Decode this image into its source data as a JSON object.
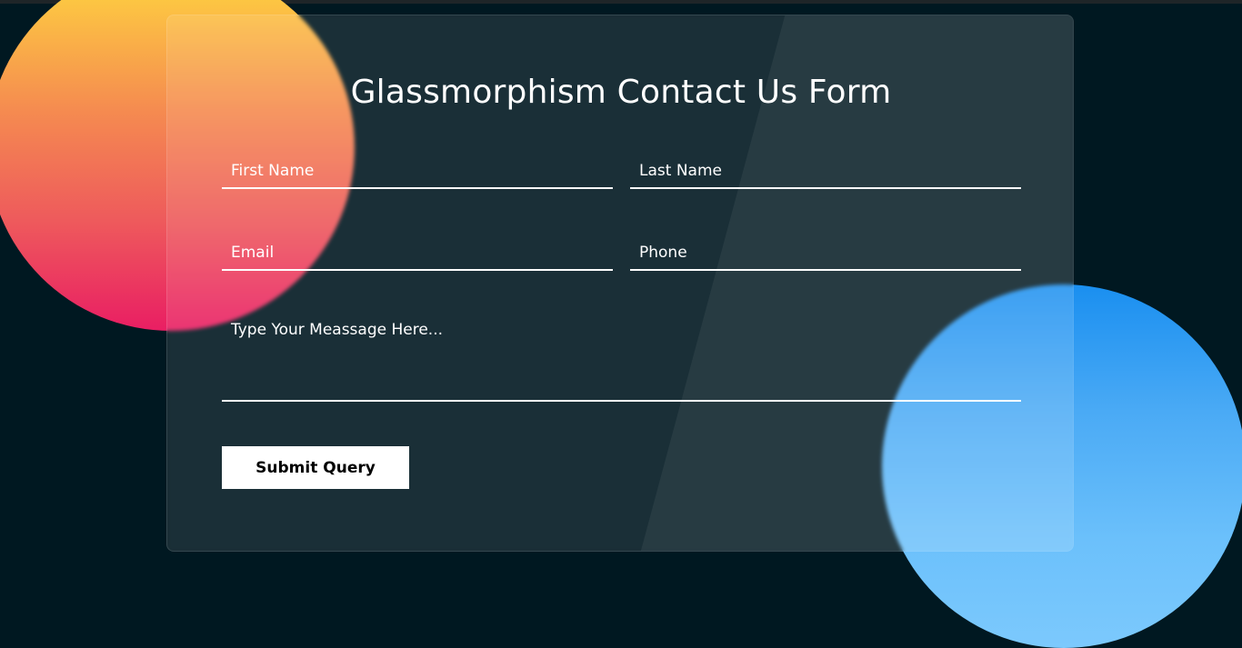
{
  "form": {
    "title": "Glassmorphism Contact Us Form",
    "fields": {
      "first_name": "First Name",
      "last_name": "Last Name",
      "email": "Email",
      "phone": "Phone",
      "message": "Type Your Meassage Here..."
    },
    "submit_label": "Submit Query"
  },
  "colors": {
    "background": "#001821",
    "warm_circle_top": "#ffd93e",
    "warm_circle_bottom": "#e91e63",
    "cool_circle_top": "#1a8ff0",
    "cool_circle_bottom": "#7cc9fd",
    "text": "#ffffff",
    "button_bg": "#ffffff",
    "button_text": "#000000"
  }
}
